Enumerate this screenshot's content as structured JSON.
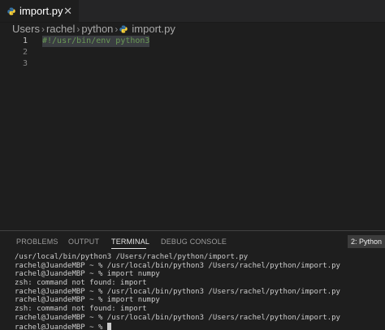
{
  "tab": {
    "label": "import.py",
    "close_glyph": "✕",
    "icon": "python-icon"
  },
  "breadcrumb": {
    "items": [
      "Users",
      "rachel",
      "python"
    ],
    "file": "import.py",
    "separator": "›"
  },
  "editor": {
    "lines": [
      {
        "number": "1",
        "text": "#!/usr/bin/env python3"
      },
      {
        "number": "2",
        "text": ""
      },
      {
        "number": "3",
        "text": ""
      }
    ]
  },
  "panel": {
    "tabs": [
      "PROBLEMS",
      "OUTPUT",
      "TERMINAL",
      "DEBUG CONSOLE"
    ],
    "active_tab": "TERMINAL",
    "terminal_selector": "2: Python"
  },
  "terminal": {
    "lines": [
      "/usr/local/bin/python3 /Users/rachel/python/import.py",
      "rachel@JuandeMBP ~ % /usr/local/bin/python3 /Users/rachel/python/import.py",
      "rachel@JuandeMBP ~ % import numpy",
      "zsh: command not found: import",
      "rachel@JuandeMBP ~ % /usr/local/bin/python3 /Users/rachel/python/import.py",
      "rachel@JuandeMBP ~ % import numpy",
      "zsh: command not found: import",
      "rachel@JuandeMBP ~ % /usr/local/bin/python3 /Users/rachel/python/import.py",
      "rachel@JuandeMBP ~ % "
    ]
  },
  "colors": {
    "editor_bg": "#1e1e1e",
    "tabbar_bg": "#252526",
    "comment": "#6a9955",
    "python_blue": "#3572a5",
    "python_yellow": "#ffd43b"
  }
}
